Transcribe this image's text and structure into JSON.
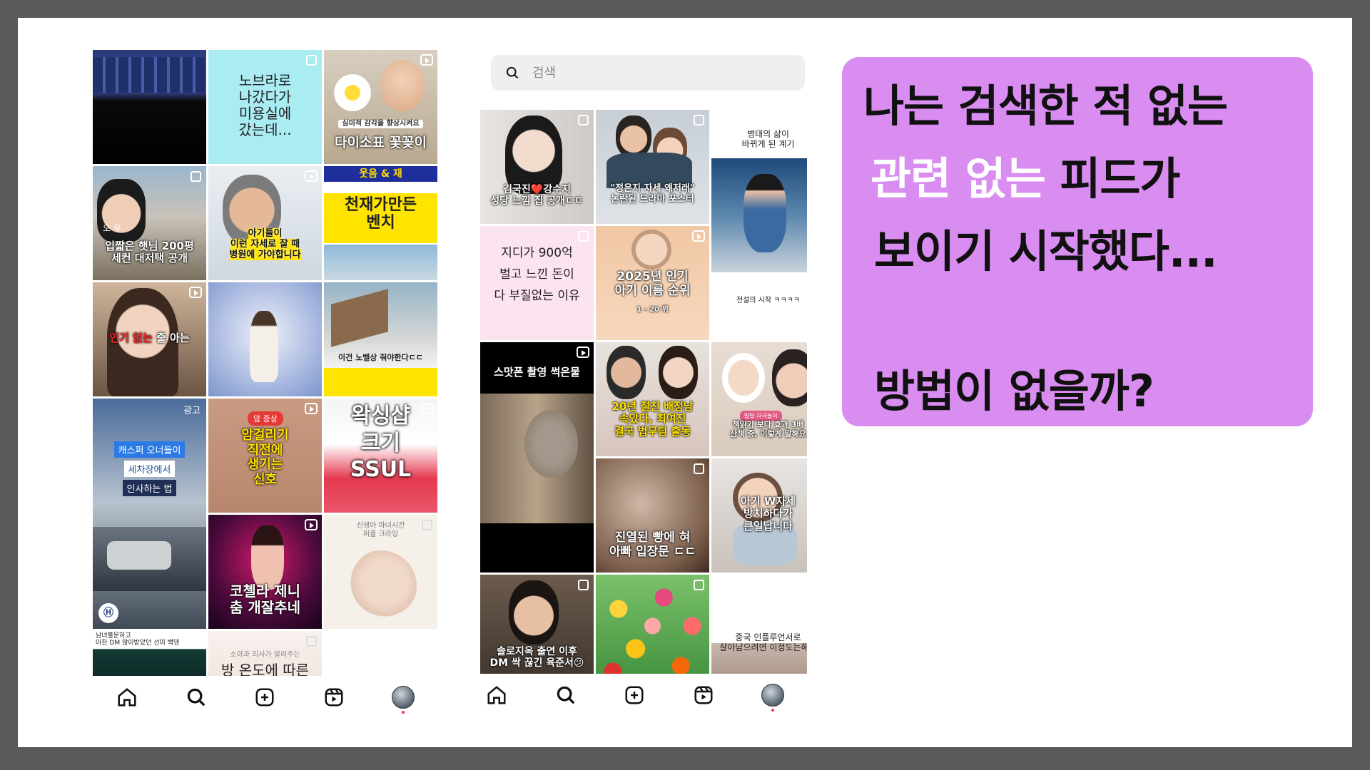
{
  "slide": {
    "background": "#5a5a5a",
    "panel": "#ffffff"
  },
  "left_feed": {
    "tiles": [
      {
        "caption": ""
      },
      {
        "caption": "노브라로\n나갔다가\n미용실에\n갔는데..."
      },
      {
        "top": "심미적 감각을 향상시켜요",
        "caption": "다이소표 꽃꽂이"
      },
      {
        "caption": "입짧은 햇님 200평\n세컨 대저택 공개",
        "overlay": "오 우"
      },
      {
        "caption": "아기들이\n이런 자세로 잘 때\n병원에 가야합니다"
      },
      {
        "caption": "천재가만든\n벤치",
        "top": "웃음 & 재"
      },
      {
        "top_red": "인기 없는",
        "caption": "줄 아는"
      },
      {
        "caption": ""
      },
      {
        "caption": "이건 노벨상 줘야한다ㄷㄷ"
      },
      {
        "badge": "광고",
        "line1": "캐스퍼 오너들이",
        "line2": "세차장에서",
        "line3": "인사하는 법"
      },
      {
        "pill": "암 증상",
        "caption": "암걸리기\n직전에\n생기는\n신호"
      },
      {
        "caption": "왁싱샵\n크기\nSSUL"
      },
      {
        "caption": "코첼라 제니\n춤 개잘추네"
      },
      {
        "top": "신생아 마녀시간\n퍼플 크라잉",
        "caption": ""
      },
      {
        "caption": "남녀불문하고\n아찬 DM 많이받았던 선미 백댄"
      },
      {
        "top": "소아과 의사가 알려주는",
        "caption": "방 온도에 따른"
      }
    ]
  },
  "right_feed": {
    "search": {
      "placeholder": "검색"
    },
    "tiles": [
      {
        "caption": "김국진❤️강수지\n성당 느낌 집 공개ㄷㄷ"
      },
      {
        "caption": "\"정은지 자세 왜저래\"\n논란된 드라마 포스터"
      },
      {
        "top": "병태의 삶이\n바뀌게 된 계기",
        "bottom": "전설의 시작 ㅋㅋㅋㅋ"
      },
      {
        "caption": "지디가 900억\n벌고 느낀 돈이\n다 부질없는 이유"
      },
      {
        "caption": "2025년 인기\n아기 이름 순위",
        "sub": "1 - 20 위"
      },
      {
        "caption": "스맛폰 촬영 썩은물"
      },
      {
        "caption": "20년 절친 배정남\n속았다, 최여진\n결국 법무팀 출동"
      },
      {
        "pill": "발달 자극놀이",
        "caption": "책읽기 보다 효과 3배\n산책 중, 이렇게 말해요"
      },
      {
        "caption": "진열된 빵에 혀\n아빠 입장문 ㄷㄷ"
      },
      {
        "caption": "아기 W자세\n방치하다가\n큰일납니다"
      },
      {
        "caption": "솔로지옥 출연 이후\nDM 싹 끊긴 육준서😕"
      },
      {
        "caption": ""
      },
      {
        "caption": "중국 인플루언서로\n살아남으려면 이정도는해야"
      }
    ]
  },
  "nav": {
    "items": [
      "home-icon",
      "search-icon",
      "create-icon",
      "reels-icon",
      "profile-avatar"
    ]
  },
  "message": {
    "line1": "나는 검색한 적 없는",
    "line2_highlight": "관련 없는",
    "line2_rest": " 피드가",
    "line3": "보이기 시작했다...",
    "line4": "방법이 없을까?",
    "bubble_color": "#d98df0",
    "highlight_color": "#ffffff"
  }
}
